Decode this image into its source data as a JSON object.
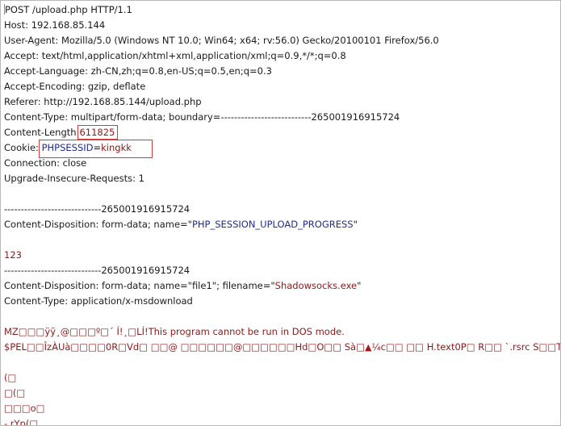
{
  "request": {
    "request_line": "POST /upload.php HTTP/1.1",
    "host": "Host: 192.168.85.144",
    "user_agent": "User-Agent: Mozilla/5.0 (Windows NT 10.0; Win64; x64; rv:56.0) Gecko/20100101 Firefox/56.0",
    "accept": "Accept: text/html,application/xhtml+xml,application/xml;q=0.9,*/*;q=0.8",
    "accept_language": "Accept-Language: zh-CN,zh;q=0.8,en-US;q=0.5,en;q=0.3",
    "accept_encoding": "Accept-Encoding: gzip, deflate",
    "referer": "Referer: http://192.168.85.144/upload.php",
    "content_type": "Content-Type: multipart/form-data; boundary=---------------------------265001916915724",
    "content_length_name": "Content-Length:",
    "content_length_value": "611825",
    "cookie_name": "Cookie:",
    "cookie_key": "PHPSESSID",
    "cookie_eq": "=",
    "cookie_value": "kingkk",
    "connection": "Connection: close",
    "upgrade": "Upgrade-Insecure-Requests: 1"
  },
  "body": {
    "boundary_1": "-----------------------------265001916915724",
    "disposition_1_prefix": "Content-Disposition: form-data; name=\"",
    "disposition_1_name": "PHP_SESSION_UPLOAD_PROGRESS",
    "disposition_1_suffix": "\"",
    "progress_value": "123",
    "boundary_2": "-----------------------------265001916915724",
    "disposition_2_prefix": "Content-Disposition: form-data; name=\"file1\"; filename=\"",
    "disposition_2_filename": "Shadowsocks.exe",
    "disposition_2_suffix": "\"",
    "content_type_2": "Content-Type: application/x-msdownload",
    "binary_1": "MZ□□□ÿÿ¸@□□□º□´        Í!¸□LÍ!This program cannot be run in DOS mode.",
    "binary_2a": "$PEL□□ÎzÀUà□□□□0R□Vd□ □□@ □□□□□□@□□□□□□Hd□O□□ Sà□",
    "binary_2b": "¼c□□ □□ H.text0P□ R□□ `.rsrc S□□T",
    "binary_3": "(□",
    "binary_4": "□(□",
    "binary_5": "□□□o□",
    "binary_6": "- rYp(□"
  }
}
